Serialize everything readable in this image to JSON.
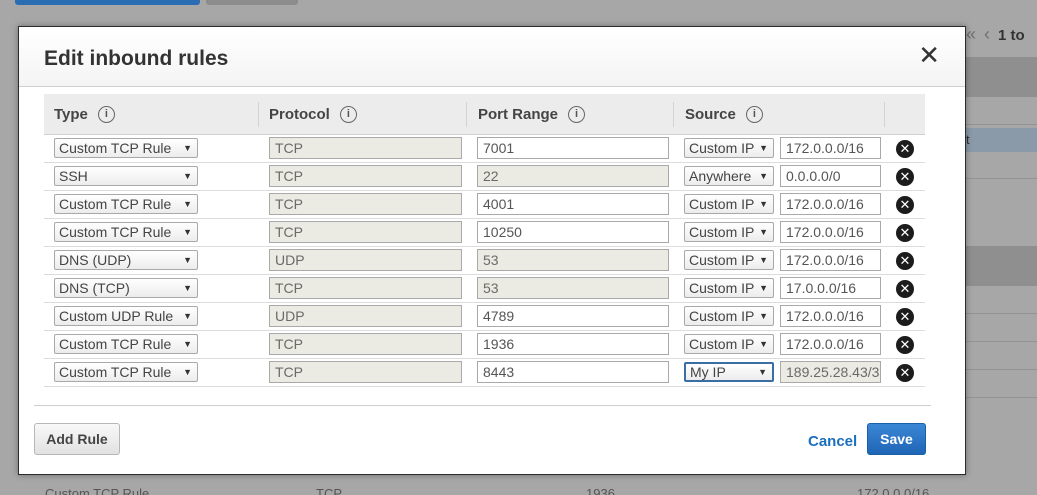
{
  "background": {
    "pager_text": "1 to",
    "strip_text": "t",
    "bottom_row": {
      "type": "Custom TCP Rule",
      "protocol": "TCP",
      "port": "1936",
      "source": "172.0.0.0/16"
    }
  },
  "modal": {
    "title": "Edit inbound rules",
    "close_symbol": "✕",
    "headers": {
      "type": "Type",
      "protocol": "Protocol",
      "port_range": "Port Range",
      "source": "Source",
      "info_symbol": "i"
    },
    "rows": [
      {
        "type": "Custom TCP Rule",
        "protocol": "TCP",
        "port": "7001",
        "port_editable": true,
        "source_type": "Custom IP",
        "source_value": "172.0.0.0/16"
      },
      {
        "type": "SSH",
        "protocol": "TCP",
        "port": "22",
        "port_editable": false,
        "source_type": "Anywhere",
        "source_value": "0.0.0.0/0"
      },
      {
        "type": "Custom TCP Rule",
        "protocol": "TCP",
        "port": "4001",
        "port_editable": true,
        "source_type": "Custom IP",
        "source_value": "172.0.0.0/16"
      },
      {
        "type": "Custom TCP Rule",
        "protocol": "TCP",
        "port": "10250",
        "port_editable": true,
        "source_type": "Custom IP",
        "source_value": "172.0.0.0/16"
      },
      {
        "type": "DNS (UDP)",
        "protocol": "UDP",
        "port": "53",
        "port_editable": false,
        "source_type": "Custom IP",
        "source_value": "172.0.0.0/16"
      },
      {
        "type": "DNS (TCP)",
        "protocol": "TCP",
        "port": "53",
        "port_editable": false,
        "source_type": "Custom IP",
        "source_value": "17.0.0.0/16"
      },
      {
        "type": "Custom UDP Rule",
        "protocol": "UDP",
        "port": "4789",
        "port_editable": true,
        "source_type": "Custom IP",
        "source_value": "172.0.0.0/16"
      },
      {
        "type": "Custom TCP Rule",
        "protocol": "TCP",
        "port": "1936",
        "port_editable": true,
        "source_type": "Custom IP",
        "source_value": "172.0.0.0/16"
      },
      {
        "type": "Custom TCP Rule",
        "protocol": "TCP",
        "port": "8443",
        "port_editable": true,
        "source_type": "My IP",
        "source_value": "189.25.28.43/3"
      }
    ],
    "delete_symbol": "✕",
    "add_rule_label": "Add Rule",
    "cancel_label": "Cancel",
    "save_label": "Save"
  }
}
